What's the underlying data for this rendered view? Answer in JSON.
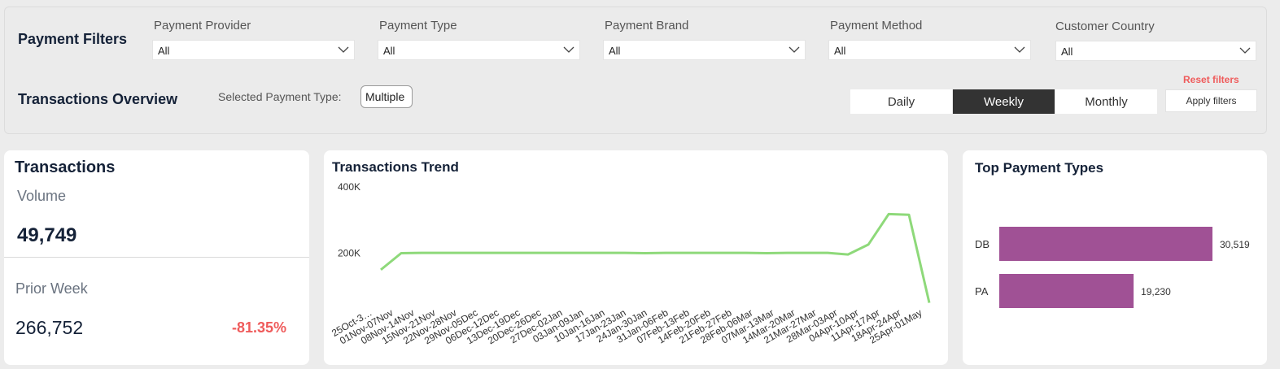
{
  "filters": {
    "heading": "Payment Filters",
    "items": [
      {
        "label": "Payment Provider",
        "value": "All"
      },
      {
        "label": "Payment Type",
        "value": "All"
      },
      {
        "label": "Payment Brand",
        "value": "All"
      },
      {
        "label": "Payment Method",
        "value": "All"
      },
      {
        "label": "Customer Country",
        "value": "All"
      }
    ]
  },
  "overview": {
    "heading": "Transactions Overview",
    "selected_label": "Selected Payment Type:",
    "selected_value": "Multiple",
    "periods": [
      "Daily",
      "Weekly",
      "Monthly"
    ],
    "active_period": "Weekly",
    "reset_label": "Reset filters",
    "apply_label": "Apply filters"
  },
  "kpi": {
    "title": "Transactions",
    "volume_label": "Volume",
    "volume_value": "49,749",
    "prior_label": "Prior Week",
    "prior_value": "266,752",
    "change": "-81.35%"
  },
  "colors": {
    "line": "#8ed97a",
    "bar": "#a05195",
    "negative": "#ef5b5b",
    "active_segment": "#333333"
  },
  "chart_data": [
    {
      "type": "line",
      "title": "Transactions Trend",
      "ylim": [
        0,
        400000
      ],
      "yticks": [
        {
          "value": 200000,
          "label": "200K"
        },
        {
          "value": 400000,
          "label": "400K"
        }
      ],
      "grid": false,
      "x": [
        "25Oct-3…",
        "01Nov-07Nov",
        "08Nov-14Nov",
        "15Nov-21Nov",
        "22Nov-28Nov",
        "29Nov-05Dec",
        "06Dec-12Dec",
        "13Dec-19Dec",
        "20Dec-26Dec",
        "27Dec-02Jan",
        "03Jan-09Jan",
        "10Jan-16Jan",
        "17Jan-23Jan",
        "24Jan-30Jan",
        "31Jan-06Feb",
        "07Feb-13Feb",
        "14Feb-20Feb",
        "21Feb-27Feb",
        "28Feb-06Mar",
        "07Mar-13Mar",
        "14Mar-20Mar",
        "21Mar-27Mar",
        "28Mar-03Apr",
        "04Apr-10Apr",
        "11Apr-17Apr",
        "18Apr-24Apr",
        "25Apr-01May"
      ],
      "series": [
        {
          "values": [
            150000,
            200000,
            201000,
            201000,
            201000,
            201000,
            201000,
            201000,
            201000,
            201000,
            201000,
            201000,
            201000,
            200000,
            201000,
            201000,
            201000,
            201000,
            201000,
            200000,
            201000,
            201000,
            201000,
            196000,
            226000,
            318000,
            316000,
            50000
          ]
        }
      ]
    },
    {
      "type": "bar",
      "orientation": "horizontal",
      "title": "Top Payment Types",
      "categories": [
        "DB",
        "PA"
      ],
      "values": [
        30519,
        19230
      ],
      "value_labels": [
        "30,519",
        "19,230"
      ]
    }
  ]
}
